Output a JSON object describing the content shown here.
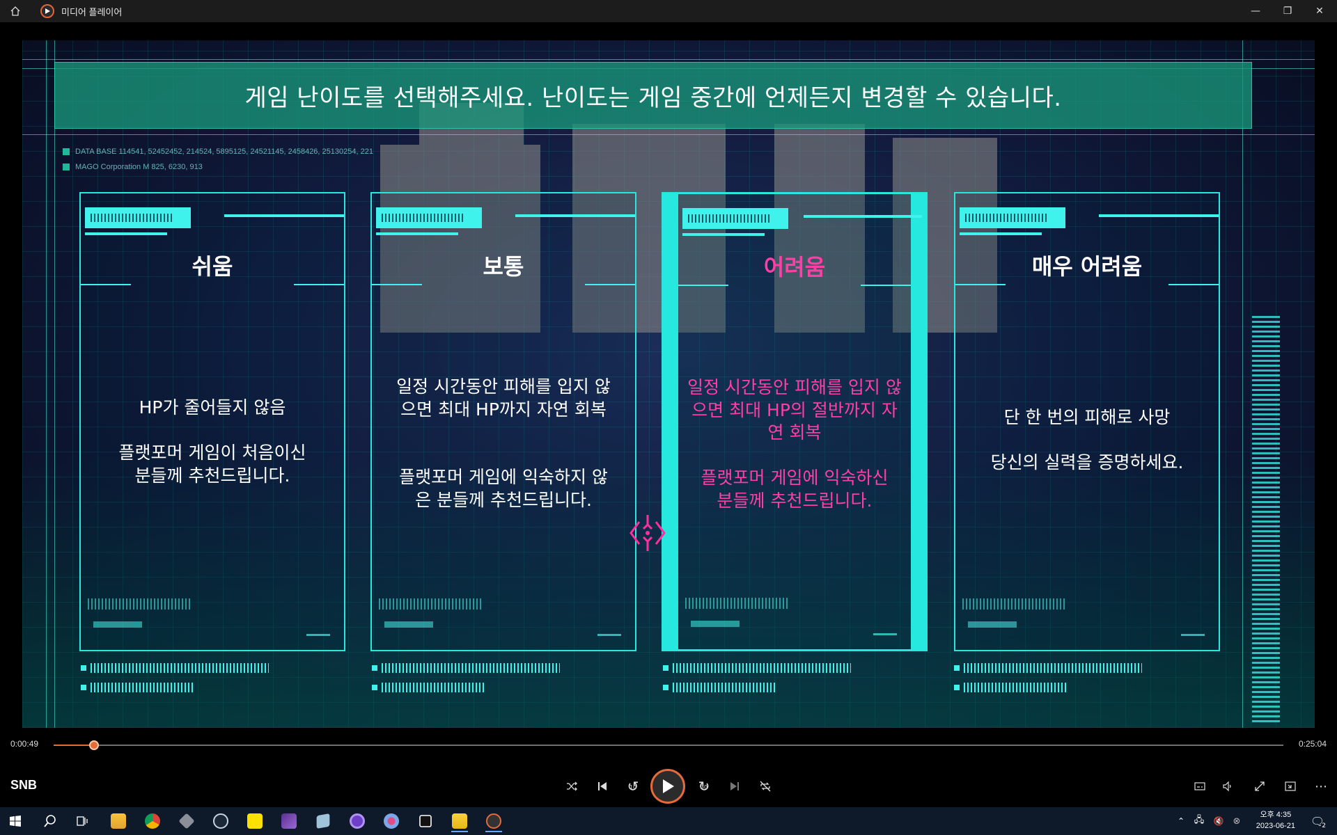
{
  "app": {
    "title": "미디어 플레이어",
    "accent": "#e56b3b"
  },
  "video": {
    "banner": "게임 난이도를 선택해주세요. 난이도는 게임 중간에 언제든지 변경할 수 있습니다.",
    "database_lines": [
      "DATA BASE 114541, 52452452, 214524, 5895125, 24521145, 2458426, 25130254, 221",
      "MAGO Corporation M 825, 6230, 913"
    ],
    "cards": [
      {
        "name": "쉬움",
        "desc1": "HP가 줄어들지 않음",
        "desc2": "플랫포머 게임이 처음이신 분들께 추천드립니다."
      },
      {
        "name": "보통",
        "desc1": "일정 시간동안 피해를 입지 않으면 최대 HP까지 자연 회복",
        "desc2": "플랫포머 게임에 익숙하지 않은 분들께 추천드립니다."
      },
      {
        "name": "어려움",
        "desc1": "일정 시간동안 피해를 입지 않으면 최대 HP의 절반까지 자연 회복",
        "desc2": "플랫포머 게임에 익숙하신 분들께 추천드립니다.",
        "selected": true
      },
      {
        "name": "매우 어려움",
        "desc1": "단 한 번의 피해로 사망",
        "desc2": "당신의 실력을 증명하세요."
      }
    ],
    "highlight_color": "#ff3fa6",
    "frame_color": "#27e8de"
  },
  "playback": {
    "current_time": "0:00:49",
    "total_time": "0:25:04",
    "progress_fraction": 0.0326,
    "now_playing": "SNB"
  },
  "controls": {
    "shuffle_icon": "shuffle-icon",
    "previous_icon": "previous-icon",
    "rewind_label": "10",
    "play_icon": "play-icon",
    "forward_label": "30",
    "next_icon": "next-icon",
    "repeat_icon": "repeat-off-icon"
  },
  "taskbar": {
    "time": "오후 4:35",
    "date": "2023-06-21",
    "notification_count": "2"
  }
}
